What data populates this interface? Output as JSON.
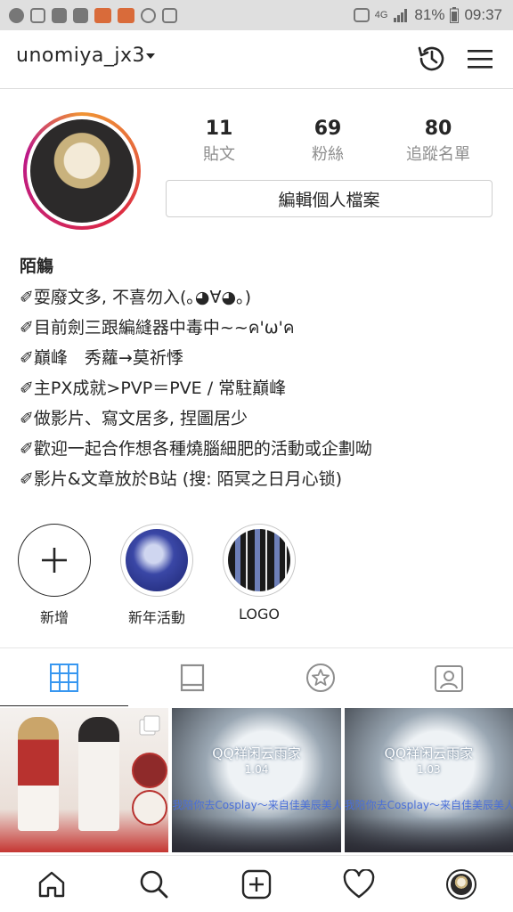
{
  "status_bar": {
    "battery": "81%",
    "time": "09:37",
    "network": "4G",
    "left_icons": [
      "tiktok-icon",
      "instagram-icon",
      "line-icon",
      "youtube-icon",
      "face-icon",
      "face-icon",
      "chat-icon",
      "gift-icon"
    ]
  },
  "header": {
    "username": "unomiya_jx3"
  },
  "profile": {
    "posts_count": "11",
    "posts_label": "貼文",
    "followers_count": "69",
    "followers_label": "粉絲",
    "following_count": "80",
    "following_label": "追蹤名單",
    "edit_button": "編輯個人檔案"
  },
  "bio": {
    "name": "陌觴",
    "lines": [
      "✐耍廢文多, 不喜勿入(｡◕∀◕｡)",
      "✐目前劍三跟編縫器中毒中~~ค'ω'ค",
      "✐巔峰　秀蘿→莫祈悸",
      "✐主PX成就>PVP＝PVE / 常駐巔峰",
      "✐做影片、寫文居多, 捏圖居少",
      "✐歡迎一起合作想各種燒腦細肥的活動或企劃呦",
      "✐影片&文章放於B站 (搜: 陌冥之日月心锁)"
    ]
  },
  "highlights": [
    {
      "label": "新增"
    },
    {
      "label": "新年活動"
    },
    {
      "label": "LOGO"
    }
  ],
  "grid_posts": [
    {
      "title": "",
      "sub": "",
      "band": ""
    },
    {
      "title": "QQ祥闲云雨家",
      "sub": "1.04",
      "band": "我陪你去Cosplay～来自佳美辰美人：小谷背景陈冰心语"
    },
    {
      "title": "QQ祥闲云雨家",
      "sub": "1.03",
      "band": "我陪你去Cosplay～来自佳美辰美人：小谷背景陈冰心语"
    }
  ],
  "colors": {
    "text": "#262626",
    "muted": "#8e8e8e",
    "active_tab": "#3897f0",
    "border": "#dbdbdb"
  }
}
